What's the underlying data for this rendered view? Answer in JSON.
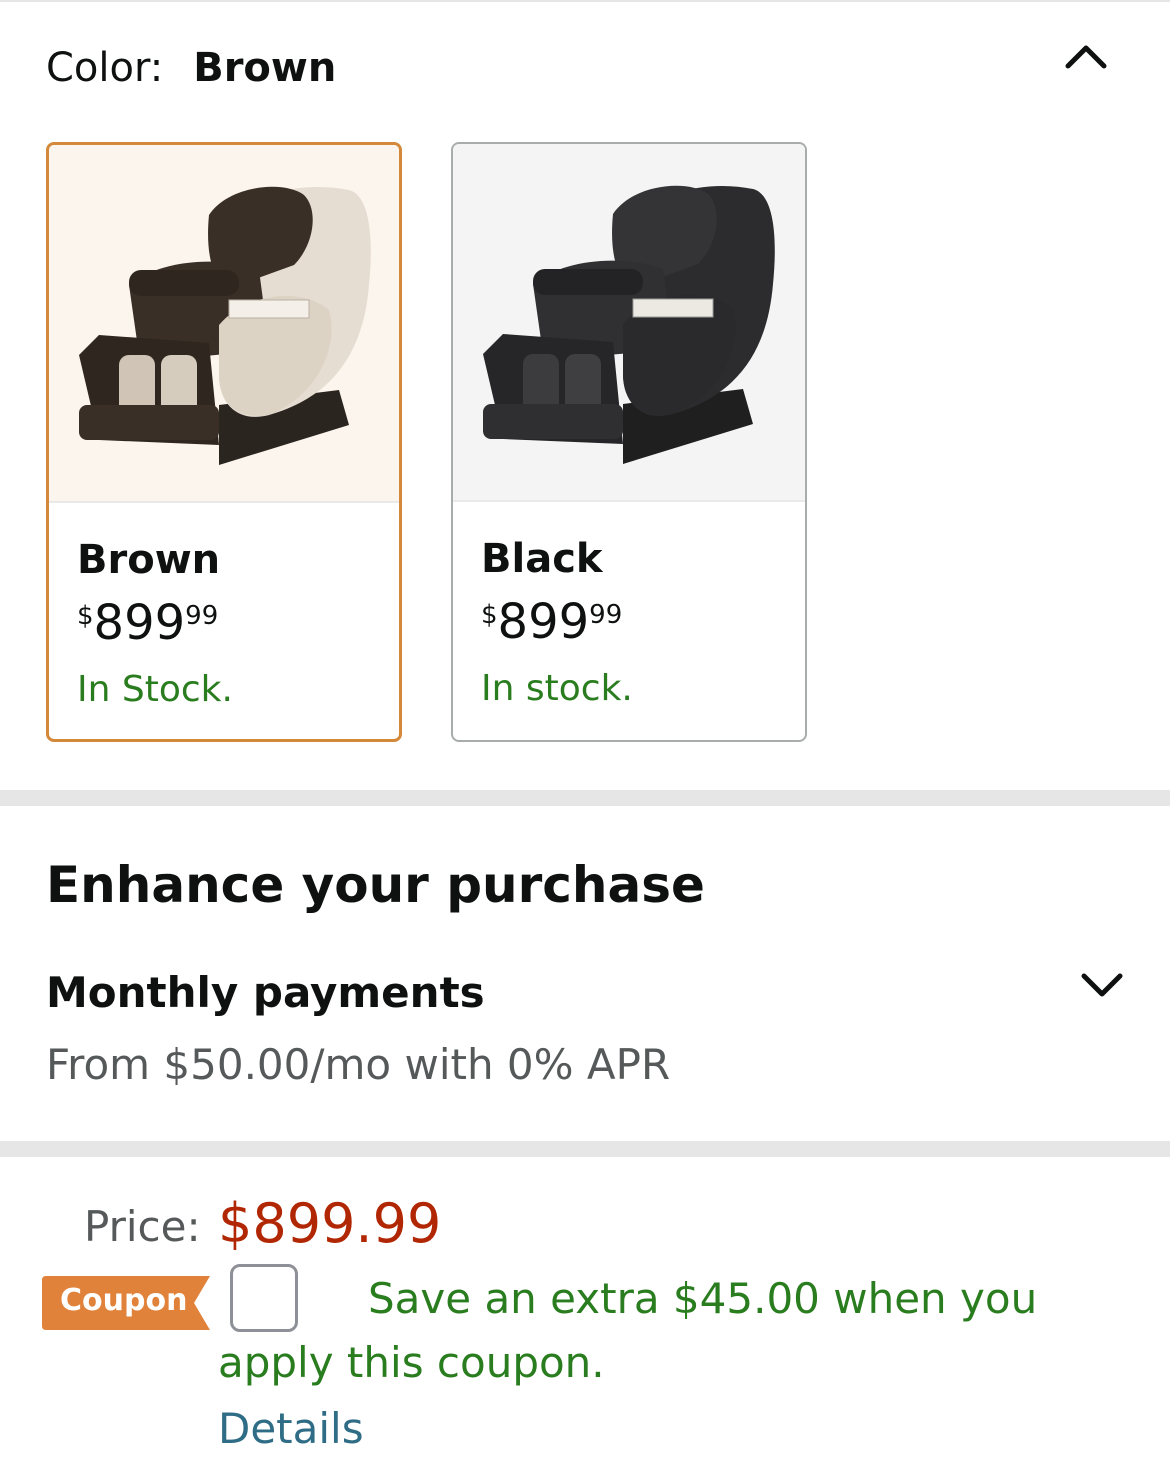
{
  "color_selector": {
    "label": "Color:",
    "selected_value": "Brown",
    "options": [
      {
        "name": "Brown",
        "price_symbol": "$",
        "price_whole": "899",
        "price_cents": "99",
        "stock": "In Stock.",
        "selected": true
      },
      {
        "name": "Black",
        "price_symbol": "$",
        "price_whole": "899",
        "price_cents": "99",
        "stock": "In stock.",
        "selected": false
      }
    ]
  },
  "enhance": {
    "title": "Enhance your purchase",
    "monthly": {
      "title": "Monthly payments",
      "description": "From $50.00/mo with 0% APR"
    }
  },
  "price_block": {
    "label": "Price:",
    "value": "$899.99",
    "coupon": {
      "badge": "Coupon",
      "text_line1": "Save an extra $45.00 when you",
      "text_line2": "apply this coupon.",
      "details_link": "Details"
    }
  },
  "colors": {
    "price_red": "#b12704",
    "stock_green": "#2a7d1f",
    "selected_border": "#d4893a",
    "coupon_orange": "#e0823a",
    "link_blue": "#2f6c85"
  }
}
